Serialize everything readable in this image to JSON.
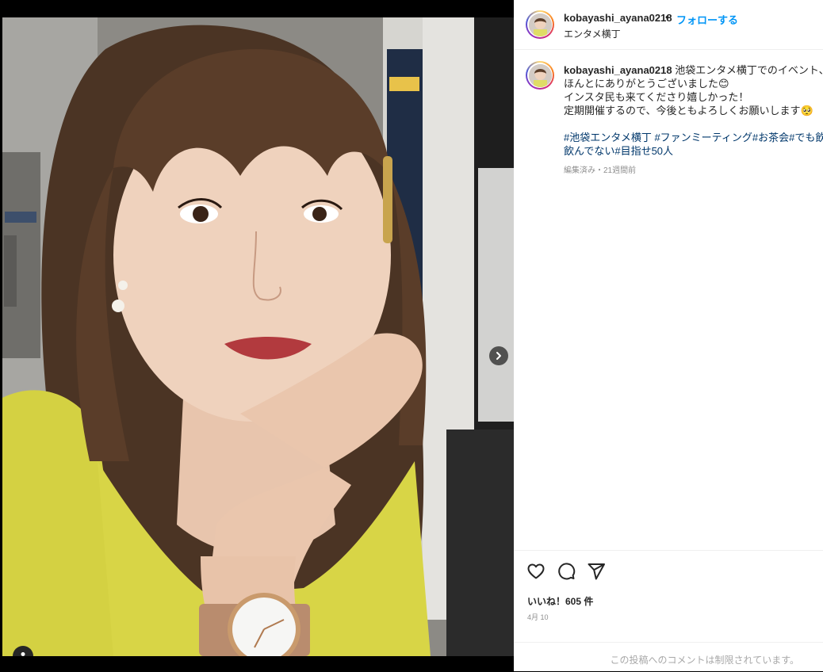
{
  "post": {
    "username": "kobayashi_ayana0218",
    "separator": "•",
    "follow_label": "フォローする",
    "location": "エンタメ横丁",
    "caption_lines": [
      "池袋エンタメ横丁でのイベント、",
      "ほんとにありがとうございました😊",
      "インスタ民も来てくださり嬉しかった！",
      "定期開催するので、今後ともよろしくお願いします🥺"
    ],
    "hashtags_line1": "#池袋エンタメ横丁 #ファンミーティング#お茶会#でも飲",
    "hashtags_line2": "飲んでない#目指せ50人",
    "edited_meta": "編集済み・21週間前",
    "likes": "いいね！605 件",
    "date": "4月 10",
    "comments_disabled": "この投稿へのコメントは制限されています。"
  },
  "icons": {
    "like": "heart-icon",
    "comment": "comment-icon",
    "share": "share-icon",
    "next": "chevron-right-icon",
    "user_tag": "person-icon"
  },
  "colors": {
    "link": "#0095f6",
    "hashtag": "#00376b",
    "muted": "#8e8e8e",
    "text": "#262626"
  }
}
